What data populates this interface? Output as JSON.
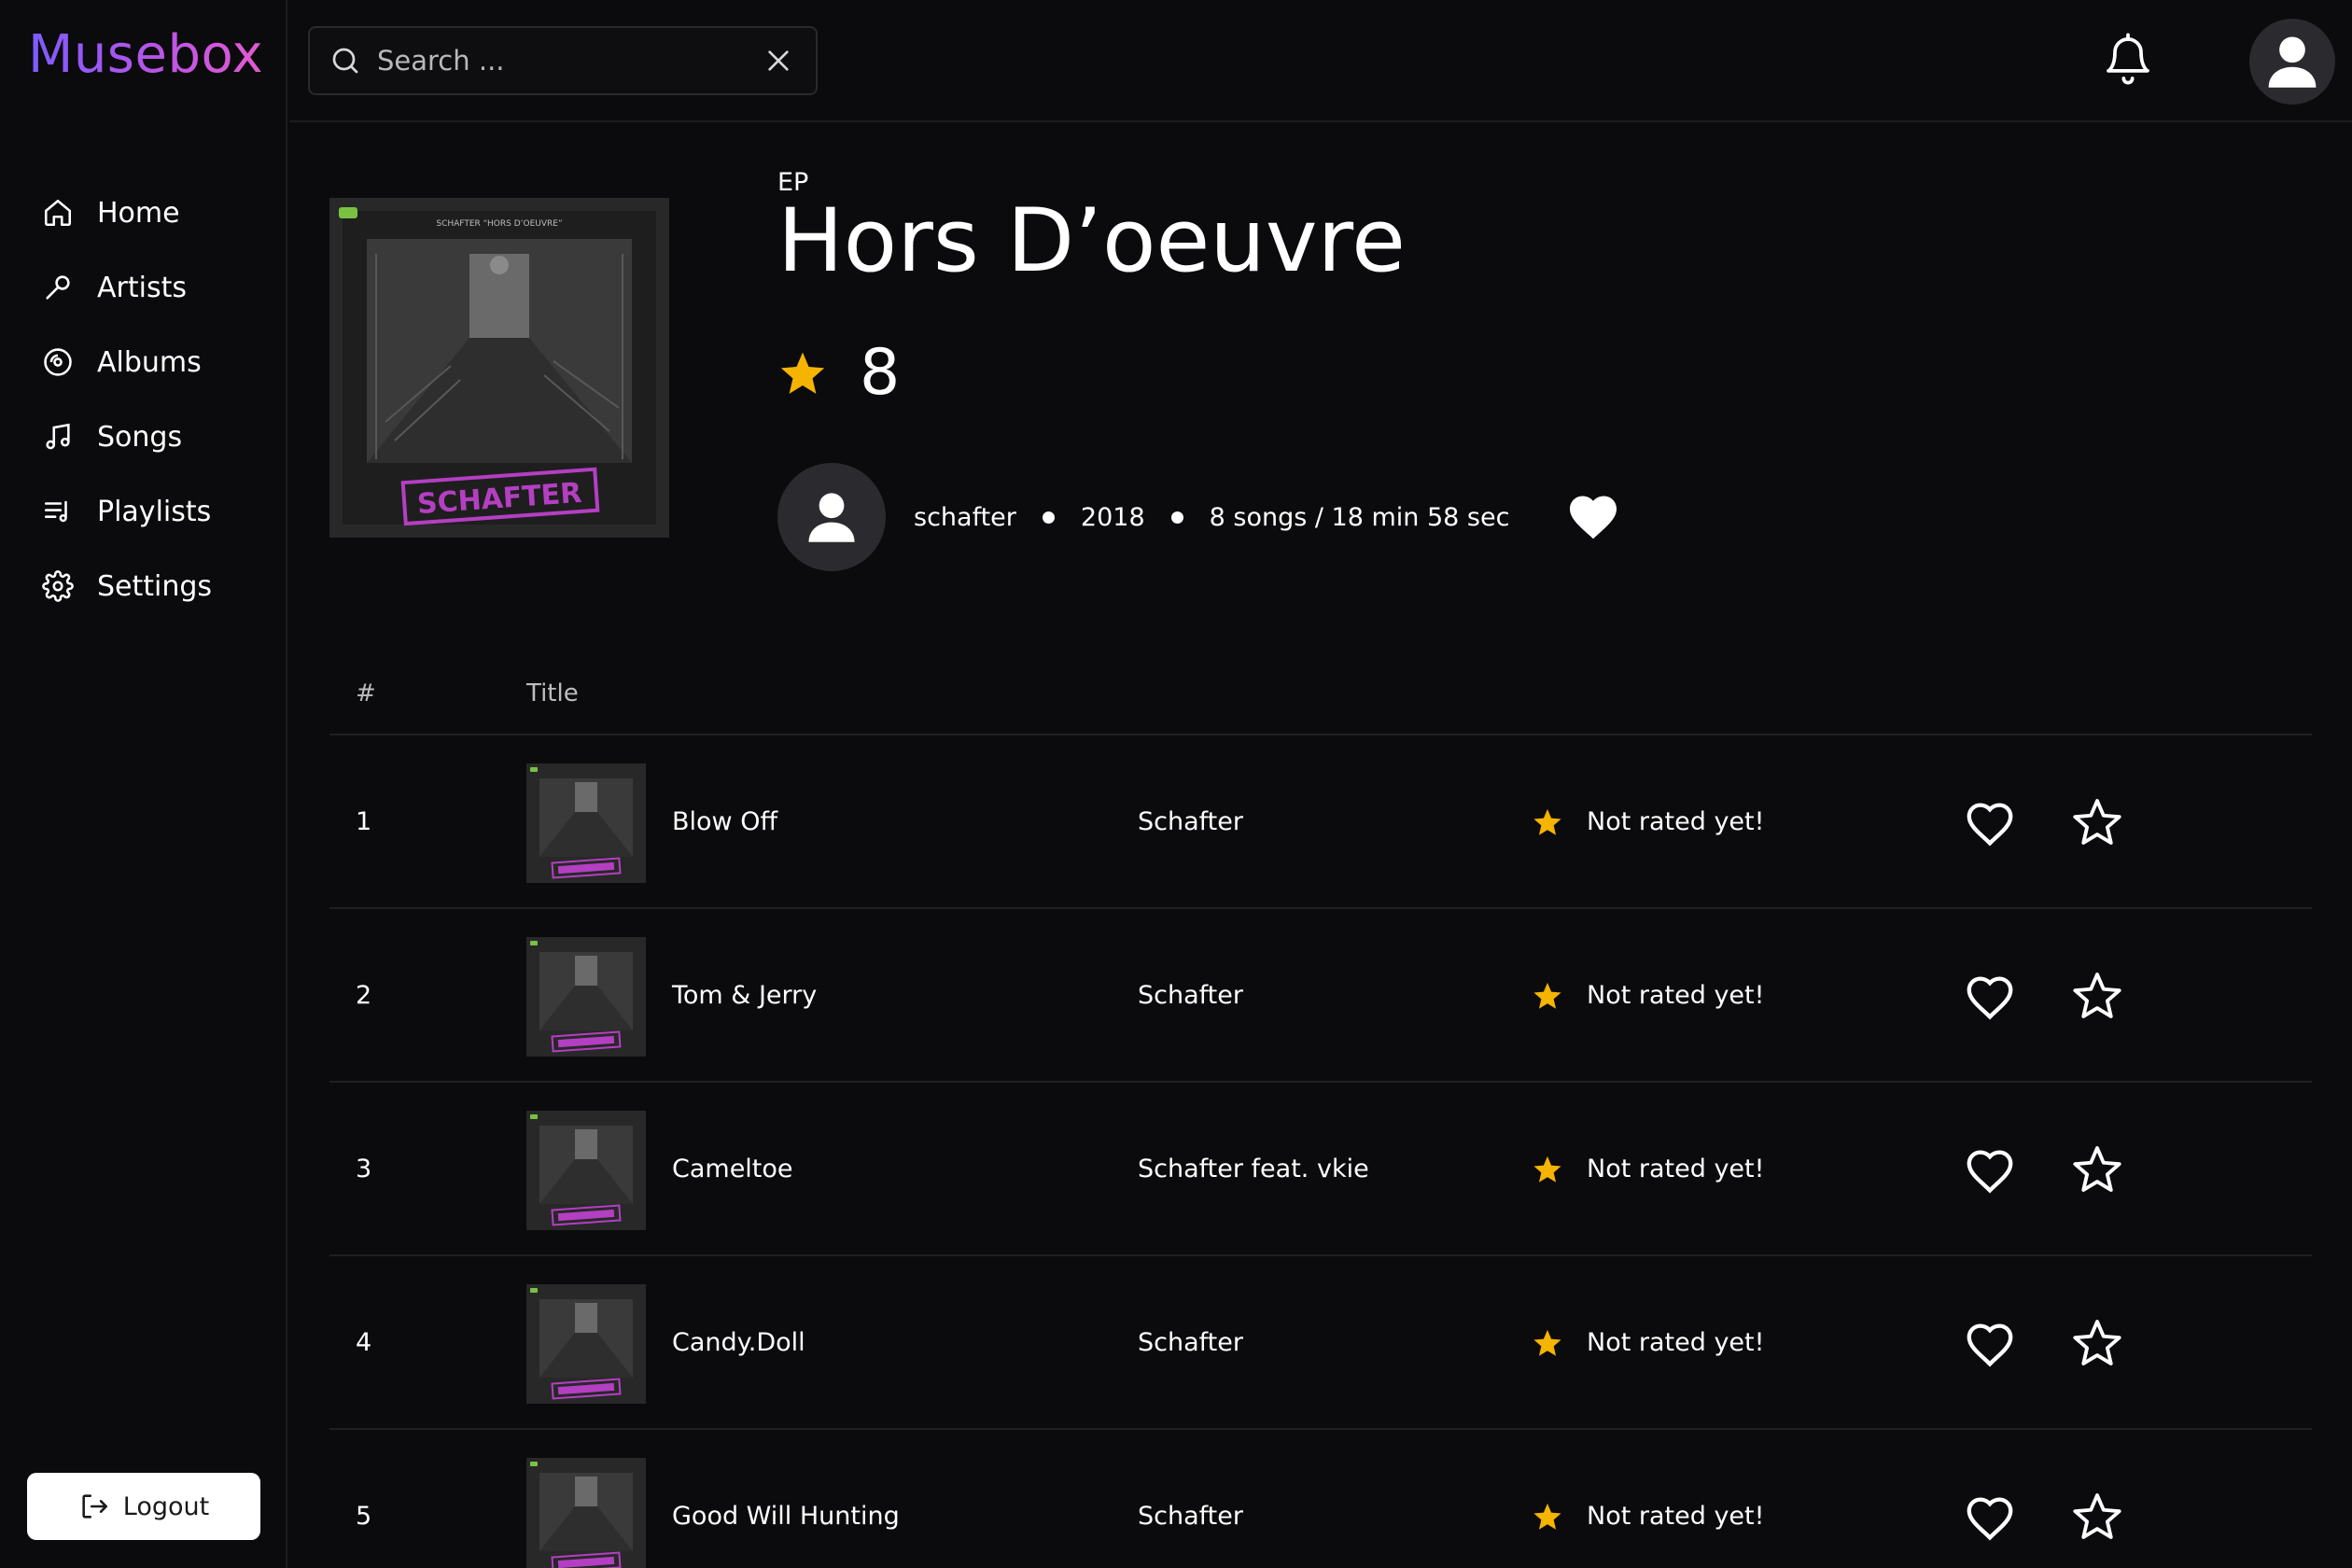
{
  "app": {
    "logo": "Musebox"
  },
  "search": {
    "placeholder": "Search ..."
  },
  "sidebar": {
    "items": [
      {
        "label": "Home",
        "icon": "home-icon"
      },
      {
        "label": "Artists",
        "icon": "microphone-icon"
      },
      {
        "label": "Albums",
        "icon": "disc-icon"
      },
      {
        "label": "Songs",
        "icon": "music-note-icon"
      },
      {
        "label": "Playlists",
        "icon": "playlist-icon"
      },
      {
        "label": "Settings",
        "icon": "gear-icon"
      }
    ],
    "logout_label": "Logout"
  },
  "album": {
    "type": "EP",
    "title": "Hors D’oeuvre",
    "rating": "8",
    "artist": "schafter",
    "year": "2018",
    "summary": "8 songs / 18 min 58 sec",
    "cover_text": "SCHAFTER “HORS D’OEUVRE”",
    "cover_logo": "SCHAFTER"
  },
  "table": {
    "headers": {
      "num": "#",
      "title": "Title"
    },
    "rows": [
      {
        "num": "1",
        "title": "Blow Off",
        "artist": "Schafter",
        "rating": "Not rated yet!"
      },
      {
        "num": "2",
        "title": "Tom & Jerry",
        "artist": "Schafter",
        "rating": "Not rated yet!"
      },
      {
        "num": "3",
        "title": "Cameltoe",
        "artist": "Schafter feat. vkie",
        "rating": "Not rated yet!"
      },
      {
        "num": "4",
        "title": "Candy.Doll",
        "artist": "Schafter",
        "rating": "Not rated yet!"
      },
      {
        "num": "5",
        "title": "Good Will Hunting",
        "artist": "Schafter",
        "rating": "Not rated yet!"
      }
    ]
  },
  "colors": {
    "background": "#0b0a0c",
    "accent_star": "#f4b400",
    "logo_gradient_start": "#7b5cff",
    "logo_gradient_end": "#e35ad0",
    "cover_sticker": "#b43fc2"
  }
}
